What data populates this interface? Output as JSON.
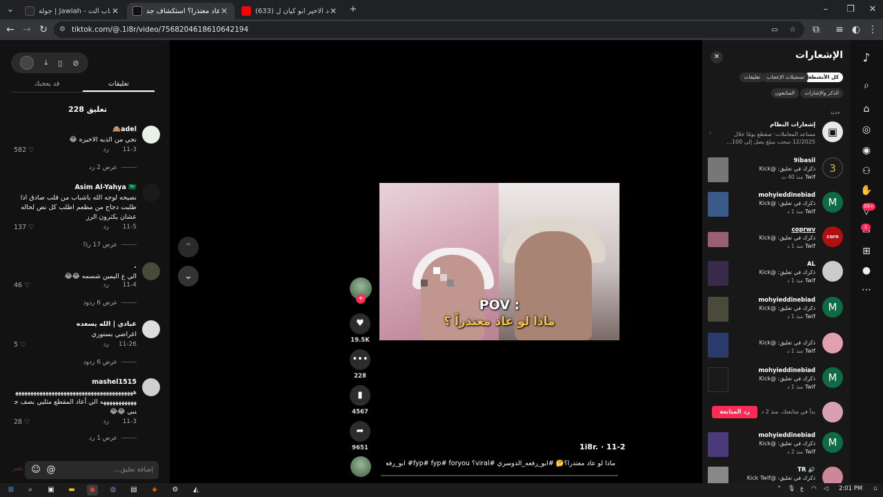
{
  "browser": {
    "tabs": [
      {
        "title": "جولة | Jawlah - منصة الألعاب الت...",
        "favicon_color": "#2b2b2b"
      },
      {
        "title": "ماذا لو عاد معتذراً؟ استكشاف جد...",
        "favicon_color": "#111111"
      },
      {
        "title": "(633) اغنية القائد الاخير ابو كيان ل...",
        "favicon_color": "#ff0000"
      }
    ],
    "new_tab": "+",
    "url": "tiktok.com/@.1i8r/video/7568204618610642194",
    "colors": {
      "tab_bg": "#202124",
      "active_tab": "#35363a"
    }
  },
  "comments_panel": {
    "tabs": {
      "comments": "تعليقات",
      "related": "قد يعجبك"
    },
    "count": "228 تعليق",
    "items": [
      {
        "user": "adel🙈",
        "text": "نجي من الذبه الاخيره 😂",
        "date": "11-3",
        "reply": "رد",
        "likes": "582",
        "more": "عرض 2 رد",
        "avatar_color": "#e9f0e6"
      },
      {
        "user": "Asim Al-Yahya 🇸🇦",
        "text": "نصيحه لوجه الله ياشباب من قلب صادق اذا طلبت دجاج من مطعم اطلب كل نص لحاله عشان يكثرون الرز",
        "date": "11-5",
        "reply": "رد",
        "likes": "137",
        "more": "عرض 17 ردًا",
        "avatar_color": "#1a1a1a"
      },
      {
        "user": ".",
        "text": "الي ع اليمين شسمه 😂😂",
        "date": "11-4",
        "reply": "رد",
        "likes": "46",
        "more": "عرض 6 ردود",
        "avatar_color": "#4a4a3a"
      },
      {
        "user": "عبادي | الله يسعده",
        "text": "اغراضي بستوري",
        "date": "11-26",
        "reply": "رد",
        "likes": "5",
        "more": "عرض 6 ردود",
        "avatar_color": "#dddddd"
      },
      {
        "user": "mashel1515",
        "text": "هههههههههههههههههههههههههههههههههههههههههههههههههههه الي أعاد المقطع مثليي بصف جنبي 😂😂",
        "date": "11-3",
        "reply": "رد",
        "likes": "28",
        "more": "عرض 1 رد",
        "avatar_color": "#cfcfcf"
      }
    ],
    "input_placeholder": "إضافة تعليق...",
    "post": "نشر"
  },
  "video": {
    "overlay_line1": "POV :",
    "overlay_line2": "ماذا لو عاد معتذراً ؟",
    "author": "1i8r. · 11-2",
    "caption": "ماذا لو عاد معتذراً؟🤔 #ابو_رفعه_الدوسري #viral؟ fyp# fyp# foryou# ابو_رفعه# ...",
    "likes": "19.5K",
    "comments": "228",
    "saves": "4567",
    "shares": "9651",
    "progress": 0.0
  },
  "notifications": {
    "title": "الإشعارات",
    "filters": [
      "كل الأنشطة",
      "تسجيلات الإعجاب",
      "تعليقات",
      "الذكر والإشارات",
      "المتابعون"
    ],
    "section": "جديد",
    "system": {
      "title": "إشعارات النظام",
      "body": "مساعد المعاملات: صقطع يومًا خلال 12/2025 سحب مبلغ يصل إلى 100..."
    },
    "items": [
      {
        "name": "9ibasil",
        "line1": "ذكرك في تعليق: @Kick",
        "line2": "Twlf",
        "time": "منذ 40 ث",
        "avatar": "3",
        "avatar_color": "#1b1b1b",
        "thumb_color": "#777777"
      },
      {
        "name": "mohyieddinebiad",
        "line1": "ذكرك في تعليق: @Kick",
        "line2": "Twlf",
        "time": "منذ 1 د",
        "avatar": "M",
        "avatar_color": "#0f6b46",
        "thumb_color": "#3a5a8a"
      },
      {
        "name": "coprwv",
        "line1": "ذكرك في تعليق: @Kick",
        "line2": "Twlf",
        "time": "منذ 1 د",
        "avatar": "corn",
        "avatar_color": "#b01010",
        "thumb_color": "#9a6070"
      },
      {
        "name": "AL",
        "line1": "ذكرك في تعليق: @Kick",
        "line2": "Twlf",
        "time": "منذ 1 د",
        "avatar": "",
        "avatar_color": "#cccccc",
        "thumb_color": "#3a2a4a"
      },
      {
        "name": "mohyieddinebiad",
        "line1": "ذكرك في تعليق: @Kick",
        "line2": "Twlf",
        "time": "منذ 1 د",
        "avatar": "M",
        "avatar_color": "#0f6b46",
        "thumb_color": "#4a4a3a"
      },
      {
        "name": "",
        "line1": "ذكرك في تعليق: @Kick",
        "line2": "Twlf",
        "time": "منذ 1 د",
        "avatar": "",
        "avatar_color": "#e0a0b0",
        "thumb_color": "#2a3a6a"
      },
      {
        "name": "mohyieddinebiad",
        "line1": "ذكرك في تعليق: @Kick",
        "line2": "Twlf",
        "time": "منذ 1 د",
        "avatar": "M",
        "avatar_color": "#0f6b46",
        "thumb_color": "#1a1a1a"
      },
      {
        "name": "",
        "line1": "بدأ في متابعتك. منذ 2 د",
        "line2": "",
        "time": "",
        "avatar": "",
        "avatar_color": "#d8a0b0",
        "thumb_color": ""
      },
      {
        "name": "mohyieddinebiad",
        "line1": "ذكرك في تعليق: @Kick",
        "line2": "Twlf",
        "time": "منذ 2 د",
        "avatar": "M",
        "avatar_color": "#0f6b46",
        "thumb_color": "#4a3a7a"
      },
      {
        "name": "TR 🔊",
        "line1": "ذكرك في تعليق: @Kick Twlf",
        "line2": "",
        "time": "",
        "avatar": "",
        "avatar_color": "#cc8899",
        "thumb_color": "#888888"
      }
    ],
    "follow_back": "رد المتابعة"
  },
  "rail": {
    "badges": {
      "activity": "99+",
      "messages": "1"
    }
  },
  "taskbar": {
    "time": "2:01 PM",
    "lang": "ع"
  }
}
